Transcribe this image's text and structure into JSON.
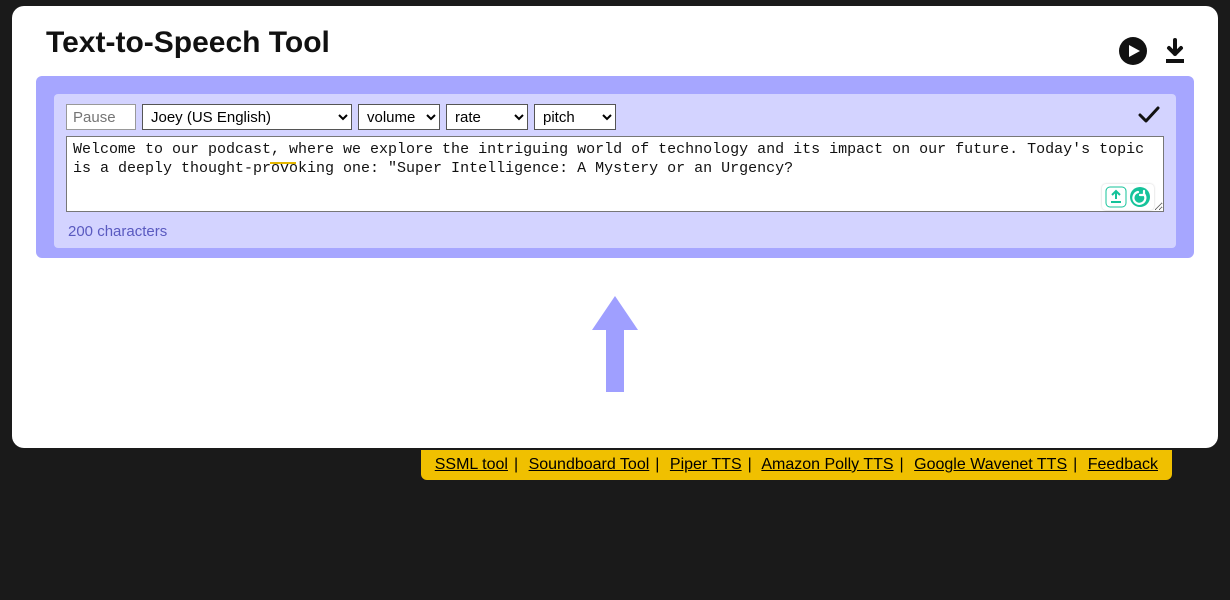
{
  "title": "Text-to-Speech Tool",
  "toolbar": {
    "pause_placeholder": "Pause",
    "voice_selected": "Joey (US English)",
    "volume_label": "volume",
    "rate_label": "rate",
    "pitch_label": "pitch"
  },
  "textarea_value": "Welcome to our podcast, where we explore the intriguing world of technology and its impact on our future. Today's topic is a deeply thought-provoking one: \"Super Intelligence: A Mystery or an Urgency?",
  "counter_text": "200 characters",
  "footer": {
    "links": [
      "SSML tool",
      "Soundboard Tool",
      "Piper TTS",
      "Amazon Polly TTS",
      "Google Wavenet TTS",
      "Feedback"
    ]
  },
  "colors": {
    "panel_outer": "#a6a6ff",
    "panel_inner": "#d3d3ff",
    "footer_bg": "#f0c000",
    "arrow": "#9f9fff"
  }
}
